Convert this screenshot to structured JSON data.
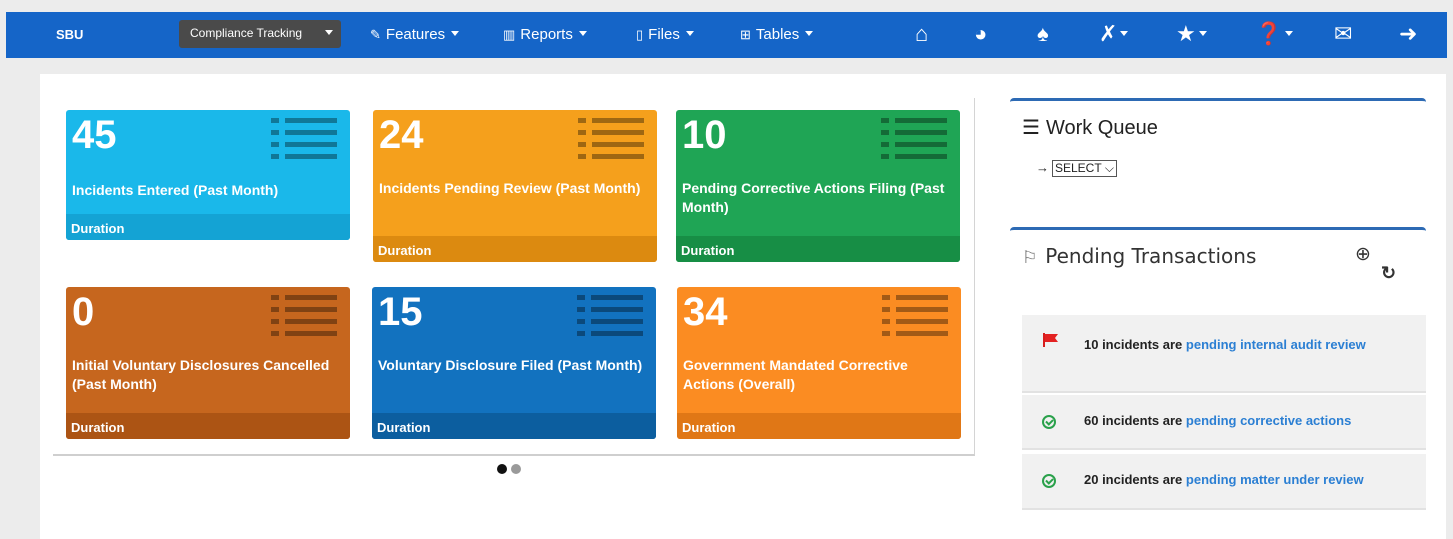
{
  "nav": {
    "brand": "SBU",
    "module": "Compliance Tracking",
    "items": [
      {
        "label": "Features",
        "icon": "pencil-icon"
      },
      {
        "label": "Reports",
        "icon": "bar-chart-icon"
      },
      {
        "label": "Files",
        "icon": "file-icon"
      },
      {
        "label": "Tables",
        "icon": "table-icon"
      }
    ],
    "right_icons": [
      "home-icon",
      "dashboard-icon",
      "bell-icon",
      "wrench-icon",
      "star-icon",
      "help-icon",
      "mail-icon",
      "logout-icon"
    ]
  },
  "tiles": [
    {
      "value": "45",
      "label": "Incidents Entered (Past Month)",
      "footer": "Duration",
      "color": "#1ab8ea",
      "footer_color": "#14a3d4"
    },
    {
      "value": "24",
      "label": "Incidents Pending Review (Past Month)",
      "footer": "Duration",
      "color": "#f5a01c",
      "footer_color": "#dc8a10"
    },
    {
      "value": "10",
      "label": "Pending Corrective Actions Filing (Past Month)",
      "footer": "Duration",
      "color": "#1fa555",
      "footer_color": "#178e45"
    },
    {
      "value": "0",
      "label": "Initial Voluntary Disclosures Cancelled (Past Month)",
      "footer": "Duration",
      "color": "#c6661e",
      "footer_color": "#ac5414"
    },
    {
      "value": "15",
      "label": "Voluntary Disclosure Filed (Past Month)",
      "footer": "Duration",
      "color": "#1272bf",
      "footer_color": "#0c5e9f"
    },
    {
      "value": "34",
      "label": "Government Mandated Corrective Actions (Overall)",
      "footer": "Duration",
      "color": "#fb8c22",
      "footer_color": "#e07716"
    }
  ],
  "carousel": {
    "pages": 2,
    "active": 1
  },
  "work_queue": {
    "title": "Work Queue",
    "select_value": "SELECT"
  },
  "pending": {
    "title": "Pending Transactions",
    "items": [
      {
        "text": "10 incidents are",
        "link": "pending internal audit review",
        "icon": "flag-icon"
      },
      {
        "text": "60 incidents are",
        "link": "pending corrective actions",
        "icon": "check-circle-icon"
      },
      {
        "text": "20 incidents are",
        "link": "pending matter under review",
        "icon": "check-circle-icon"
      }
    ]
  }
}
